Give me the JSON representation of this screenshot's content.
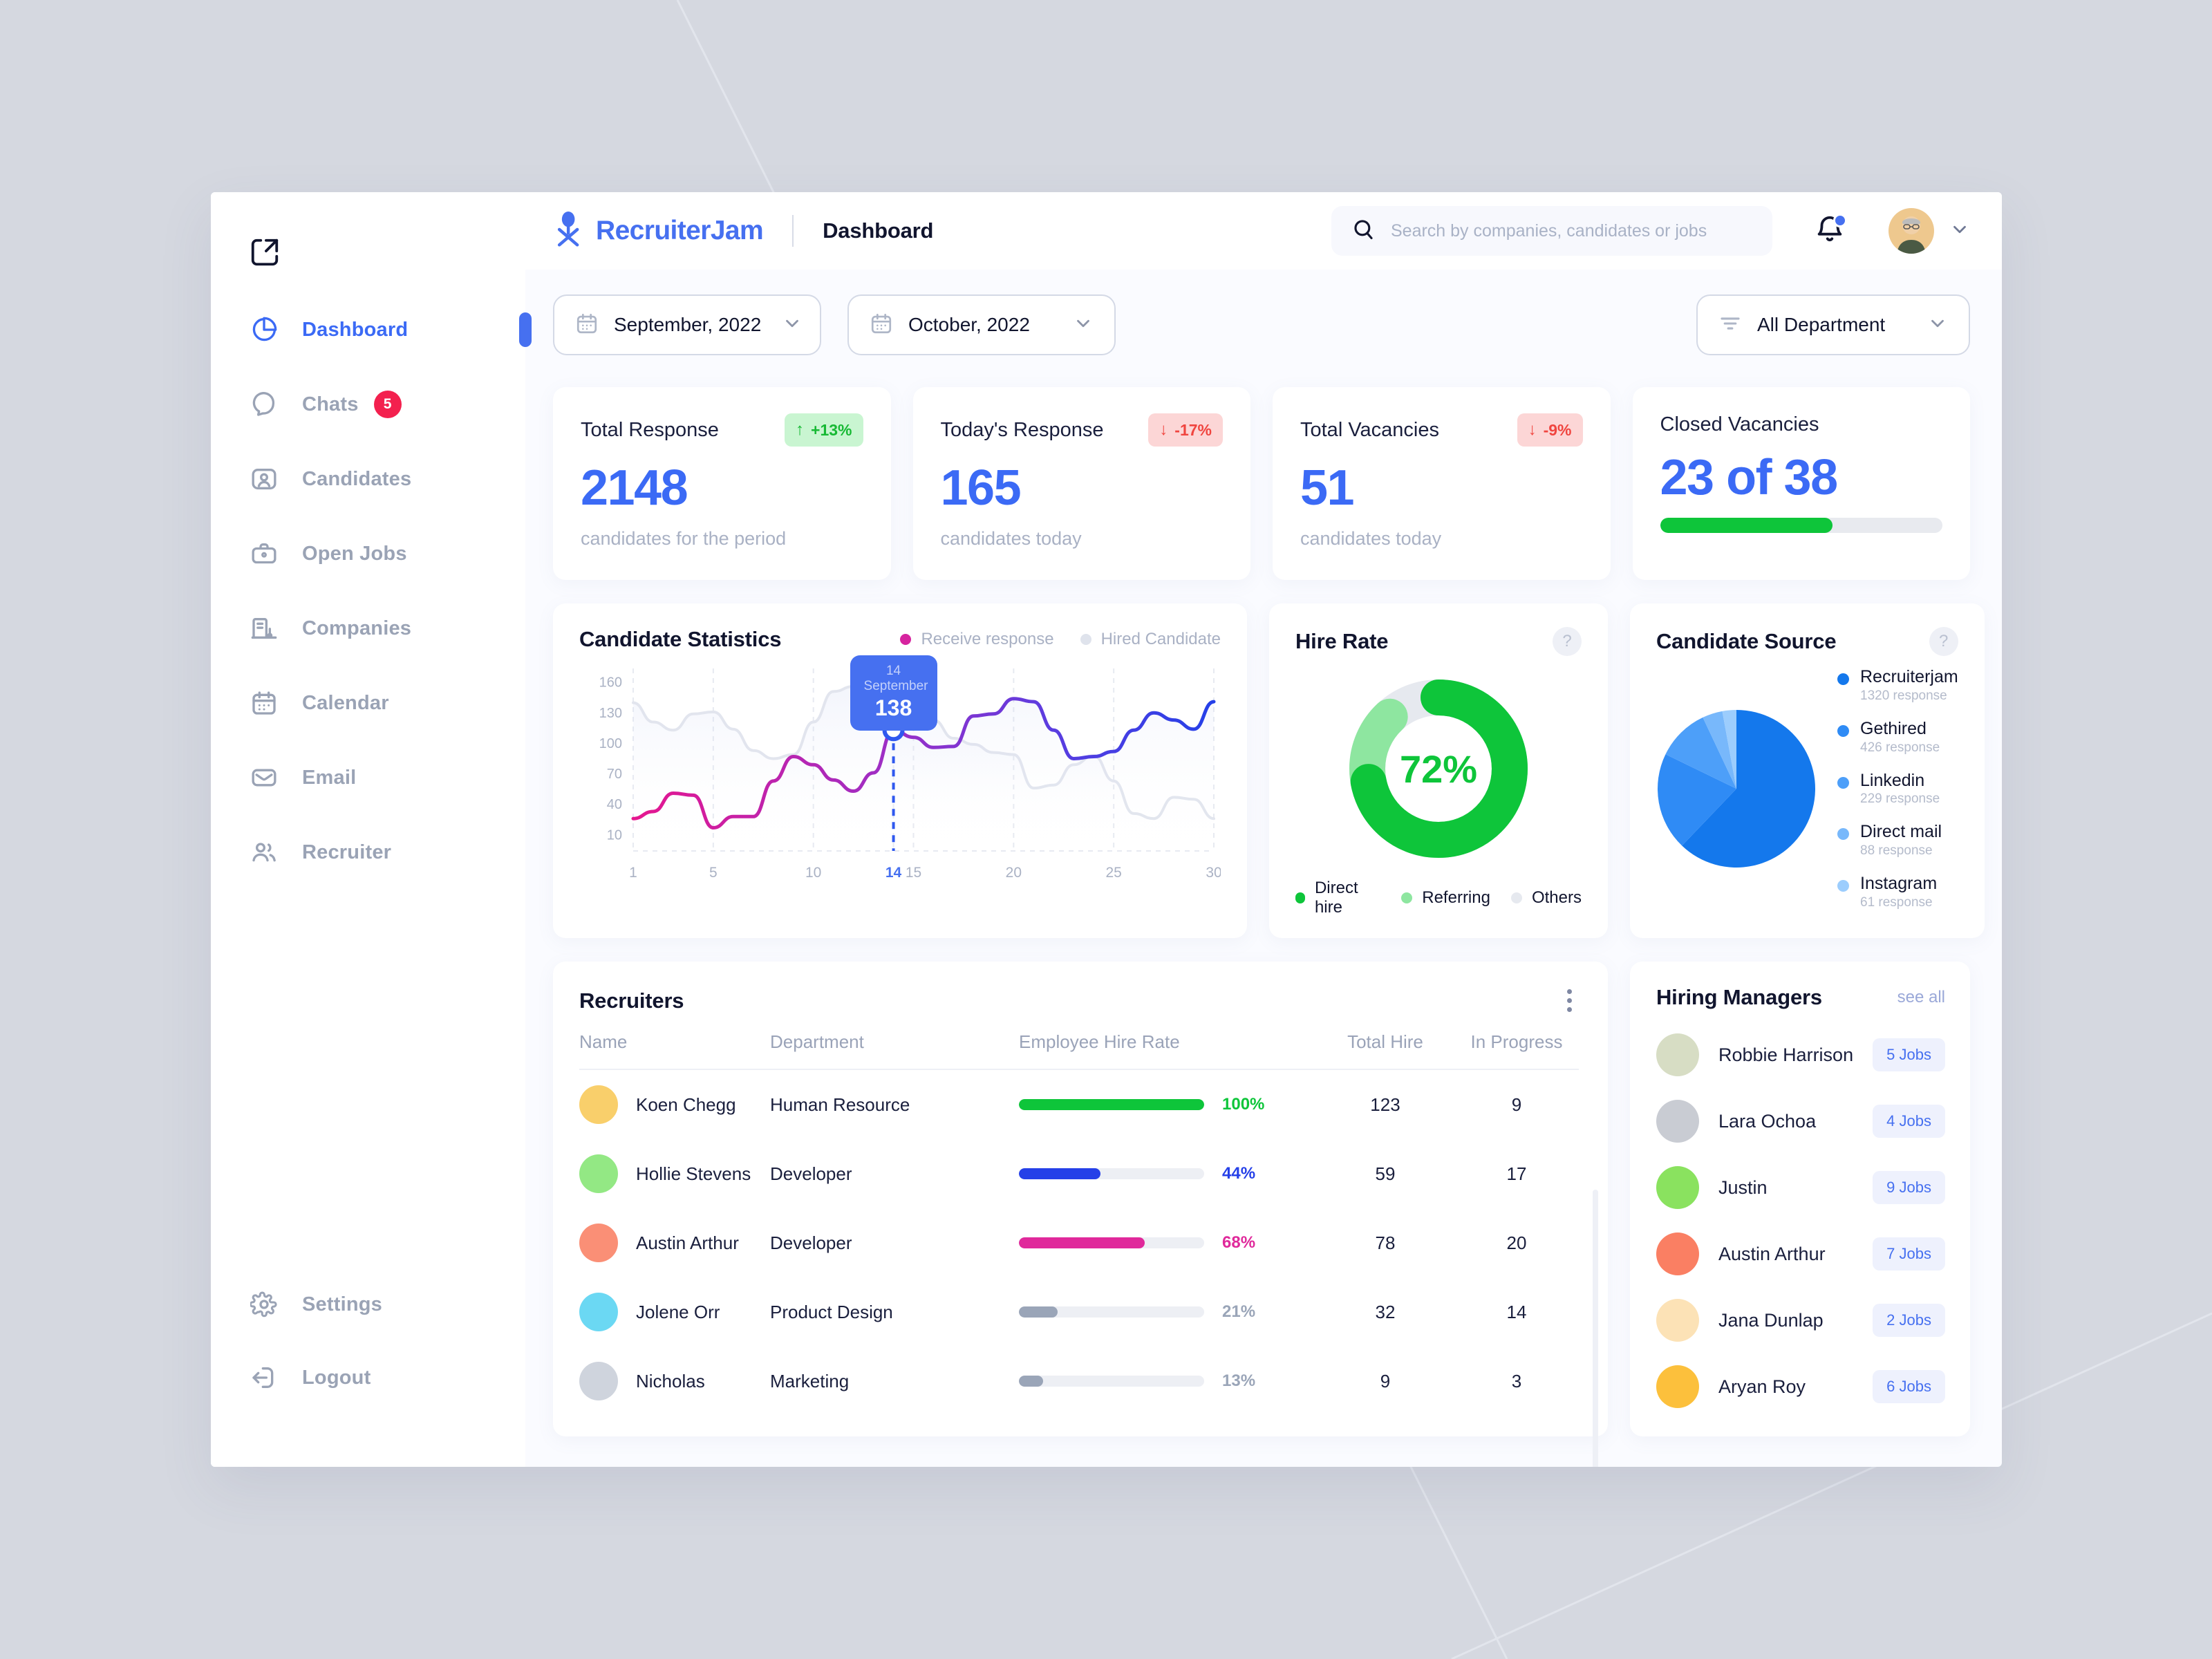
{
  "app": {
    "brand_name": "RecruiterJam",
    "page_title": "Dashboard",
    "logo_icon": "recruiter-person-icon",
    "collapse_icon": "collapse-panel-icon"
  },
  "search": {
    "placeholder": "Search by companies, candidates or jobs",
    "value": "",
    "icon": "search-icon"
  },
  "topbar": {
    "notification_icon": "bell-icon",
    "avatar_icon": "user-avatar",
    "chevron_icon": "chevron-down-icon"
  },
  "sidebar": {
    "items": [
      {
        "label": "Dashboard",
        "icon": "pie-chart-icon",
        "active": true,
        "badge": ""
      },
      {
        "label": "Chats",
        "icon": "chat-bubble-icon",
        "active": false,
        "badge": "5"
      },
      {
        "label": "Candidates",
        "icon": "user-card-icon",
        "active": false,
        "badge": ""
      },
      {
        "label": "Open Jobs",
        "icon": "briefcase-icon",
        "active": false,
        "badge": ""
      },
      {
        "label": "Companies",
        "icon": "building-icon",
        "active": false,
        "badge": ""
      },
      {
        "label": "Calendar",
        "icon": "calendar-icon",
        "active": false,
        "badge": ""
      },
      {
        "label": "Email",
        "icon": "envelope-icon",
        "active": false,
        "badge": ""
      },
      {
        "label": "Recruiter",
        "icon": "users-icon",
        "active": false,
        "badge": ""
      }
    ],
    "bottom_items": [
      {
        "label": "Settings",
        "icon": "gear-icon"
      },
      {
        "label": "Logout",
        "icon": "logout-icon"
      }
    ]
  },
  "filters": {
    "month_from": "September, 2022",
    "month_to": "October, 2022",
    "department": "All Department",
    "calendar_icon": "calendar-icon",
    "filter_icon": "filter-lines-icon",
    "chevron_icon": "chevron-down-icon"
  },
  "stats": [
    {
      "title": "Total Response",
      "value": "2148",
      "delta": "+13%",
      "delta_dir": "up",
      "sub": "candidates for the period"
    },
    {
      "title": "Today's Response",
      "value": "165",
      "delta": "-17%",
      "delta_dir": "down",
      "sub": "candidates today"
    },
    {
      "title": "Total Vacancies",
      "value": "51",
      "delta": "-9%",
      "delta_dir": "down",
      "sub": "candidates today"
    },
    {
      "title": "Closed Vacancies",
      "value": "23 of 38",
      "delta": "",
      "delta_dir": "",
      "sub": "",
      "progress_percent": 61
    }
  ],
  "candidate_statistics": {
    "title": "Candidate Statistics",
    "legend": [
      {
        "label": "Receive response",
        "color": "#d6249f"
      },
      {
        "label": "Hired Candidate",
        "color": "#dfe3ec"
      }
    ],
    "tooltip": {
      "date": "14 September",
      "value": "138"
    }
  },
  "hire_rate": {
    "title": "Hire Rate",
    "center_value": "72%",
    "help_icon": "help-question-icon",
    "legend": [
      {
        "label": "Direct hire",
        "color": "#0ec53a"
      },
      {
        "label": "Referring",
        "color": "#8ee6a0"
      },
      {
        "label": "Others",
        "color": "#e6e9ef"
      }
    ]
  },
  "candidate_source": {
    "title": "Candidate Source",
    "help_icon": "help-question-icon",
    "items": [
      {
        "name": "Recruiterjam",
        "count": "1320 response",
        "color": "#1478ec"
      },
      {
        "name": "Gethired",
        "count": "426 response",
        "color": "#2f8bf5"
      },
      {
        "name": "Linkedin",
        "count": "229 response",
        "color": "#4d9ff9"
      },
      {
        "name": "Direct mail",
        "count": "88 response",
        "color": "#78b8fb"
      },
      {
        "name": "Instagram",
        "count": "61 response",
        "color": "#9ccdfd"
      }
    ]
  },
  "recruiters": {
    "title": "Recruiters",
    "menu_icon": "more-vertical-icon",
    "columns": [
      "Name",
      "Department",
      "Employee Hire Rate",
      "Total Hire",
      "In Progress"
    ],
    "rows": [
      {
        "name": "Koen Chegg",
        "department": "Human Resource",
        "rate": "100%",
        "rate_value": 100,
        "rate_color": "#0ec53a",
        "total_hire": "123",
        "in_progress": "9",
        "avatar_bg": "#f9cf6b"
      },
      {
        "name": "Hollie Stevens",
        "department": "Developer",
        "rate": "44%",
        "rate_value": 44,
        "rate_color": "#2540e8",
        "total_hire": "59",
        "in_progress": "17",
        "avatar_bg": "#93e884"
      },
      {
        "name": "Austin Arthur",
        "department": "Developer",
        "rate": "68%",
        "rate_value": 68,
        "rate_color": "#e0299b",
        "total_hire": "78",
        "in_progress": "20",
        "avatar_bg": "#fa8f76"
      },
      {
        "name": "Jolene Orr",
        "department": "Product Design",
        "rate": "21%",
        "rate_value": 21,
        "rate_color": "#9aa5b8",
        "total_hire": "32",
        "in_progress": "14",
        "avatar_bg": "#6bd8f3"
      },
      {
        "name": "Nicholas",
        "department": "Marketing",
        "rate": "13%",
        "rate_value": 13,
        "rate_color": "#9aa5b8",
        "total_hire": "9",
        "in_progress": "3",
        "avatar_bg": "#cfd4dd"
      }
    ]
  },
  "hiring_managers": {
    "title": "Hiring Managers",
    "see_all": "see all",
    "items": [
      {
        "name": "Robbie Harrison",
        "jobs": "5 Jobs",
        "avatar_bg": "#d7ddc4"
      },
      {
        "name": "Lara Ochoa",
        "jobs": "4 Jobs",
        "avatar_bg": "#c9ccd3"
      },
      {
        "name": "Justin",
        "jobs": "9 Jobs",
        "avatar_bg": "#8ae25f"
      },
      {
        "name": "Austin Arthur",
        "jobs": "7 Jobs",
        "avatar_bg": "#fa7f63"
      },
      {
        "name": "Jana Dunlap",
        "jobs": "2 Jobs",
        "avatar_bg": "#fce2b6"
      },
      {
        "name": "Aryan Roy",
        "jobs": "6 Jobs",
        "avatar_bg": "#fcc03c"
      }
    ]
  },
  "chart_data": [
    {
      "type": "line",
      "title": "Candidate Statistics",
      "xlabel": "",
      "ylabel": "",
      "ylim": [
        0,
        170
      ],
      "yticks": [
        10,
        40,
        70,
        100,
        130,
        160
      ],
      "xticks": [
        1,
        5,
        10,
        14,
        15,
        20,
        25,
        30
      ],
      "grid": true,
      "legend_position": "top-right",
      "highlight": {
        "x": 14,
        "label": "14 September",
        "value": 138
      },
      "series": [
        {
          "name": "Receive response",
          "color": "#d6249f",
          "x": [
            1,
            2,
            3,
            4,
            5,
            6,
            7,
            8,
            9,
            10,
            11,
            12,
            13,
            14,
            15,
            16,
            17,
            18,
            19,
            20,
            21,
            22,
            23,
            24,
            25,
            26,
            27,
            28,
            29,
            30
          ],
          "values": [
            25,
            32,
            50,
            48,
            16,
            27,
            27,
            62,
            86,
            78,
            63,
            52,
            70,
            112,
            105,
            95,
            96,
            126,
            128,
            143,
            140,
            112,
            84,
            86,
            91,
            112,
            129,
            122,
            113,
            140
          ]
        },
        {
          "name": "Hired Candidate",
          "color": "#dfe3ec",
          "x": [
            1,
            2,
            3,
            4,
            5,
            6,
            7,
            8,
            9,
            10,
            11,
            12,
            13,
            14,
            15,
            16,
            17,
            18,
            19,
            20,
            21,
            22,
            23,
            24,
            25,
            26,
            27,
            28,
            29,
            30
          ],
          "values": [
            139,
            120,
            112,
            128,
            130,
            113,
            92,
            84,
            88,
            120,
            150,
            155,
            153,
            148,
            140,
            122,
            104,
            98,
            90,
            88,
            55,
            58,
            78,
            87,
            62,
            30,
            25,
            46,
            44,
            25
          ]
        }
      ]
    },
    {
      "type": "pie",
      "title": "Hire Rate",
      "center_label": "72%",
      "categories": [
        "Direct hire",
        "Referring",
        "Others"
      ],
      "values": [
        72,
        16,
        12
      ],
      "colors": [
        "#0ec53a",
        "#8ee6a0",
        "#e6e9ef"
      ],
      "legend_position": "bottom"
    },
    {
      "type": "pie",
      "title": "Candidate Source",
      "categories": [
        "Recruiterjam",
        "Gethired",
        "Linkedin",
        "Direct mail",
        "Instagram"
      ],
      "values": [
        1320,
        426,
        229,
        88,
        61
      ],
      "colors": [
        "#1478ec",
        "#2f8bf5",
        "#4d9ff9",
        "#78b8fb",
        "#9ccdfd"
      ],
      "legend_position": "right"
    }
  ]
}
